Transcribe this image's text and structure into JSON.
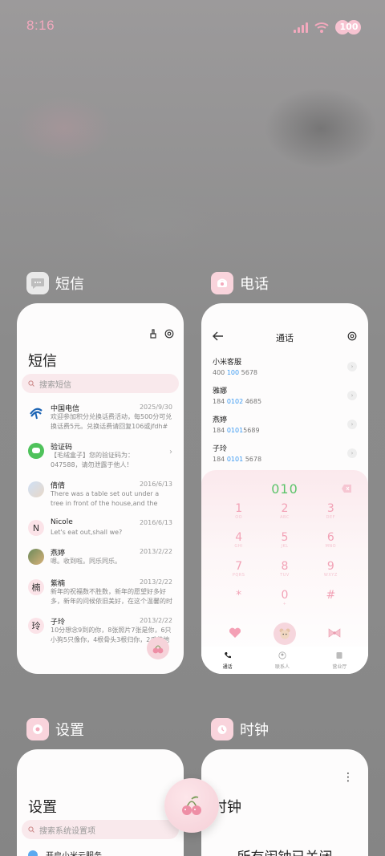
{
  "status_bar": {
    "time": "8:16",
    "battery": "100"
  },
  "apps": [
    {
      "name": "短信"
    },
    {
      "name": "电话"
    },
    {
      "name": "设置"
    },
    {
      "name": "时钟"
    }
  ],
  "sms": {
    "title": "短信",
    "search_placeholder": "搜索短信",
    "messages": [
      {
        "name": "中国电信",
        "date": "2025/9/30",
        "preview": "欢迎参加积分兑换话费活动，每500分可兑换话费5元。兑换话费请回复106或jfdh#话费..."
      },
      {
        "name": "验证码",
        "date": "",
        "preview": "【毛绒盒子】您的验证码为：047588，请勿泄露于他人！"
      },
      {
        "name": "倩倩",
        "date": "2016/6/13",
        "preview": "There was a table set out under a tree in front of the house,and the March Hare an..."
      },
      {
        "name": "Nicole",
        "date": "2016/6/13",
        "preview": "Let's eat out,shall we?"
      },
      {
        "name": "燕婷",
        "date": "2013/2/22",
        "preview": "嗯。收到啦。同乐同乐。"
      },
      {
        "name": "紫楠",
        "date": "2013/2/22",
        "preview": "新年的祝福数不胜数，新年的愿望好多好多，新年的问候依旧美好，在这个温馨的时刻..."
      },
      {
        "name": "子玲",
        "date": "2013/2/22",
        "preview": "10分想念9到的你，8张照片7张是你，6只小狗5只像你，4根骨头3根归你，2爪着地1定..."
      }
    ],
    "avatar_letters": [
      "N",
      "楠",
      "玲"
    ]
  },
  "phone": {
    "title": "通话",
    "contacts": [
      {
        "name": "小米客服",
        "pre": "400 ",
        "hl": "100",
        "post": " 5678"
      },
      {
        "name": "雅娜",
        "pre": "184 ",
        "hl": "0102",
        "post": " 4685"
      },
      {
        "name": "燕婷",
        "pre": "184 ",
        "hl": "0101",
        "post": "5689"
      },
      {
        "name": "子玲",
        "pre": "184 ",
        "hl": "0101",
        "post": " 5678"
      }
    ],
    "dial_number": "010",
    "keys": [
      {
        "d": "1",
        "s": "OO"
      },
      {
        "d": "2",
        "s": "ABC"
      },
      {
        "d": "3",
        "s": "DEF"
      },
      {
        "d": "4",
        "s": "GHI"
      },
      {
        "d": "5",
        "s": "JKL"
      },
      {
        "d": "6",
        "s": "MNO"
      },
      {
        "d": "7",
        "s": "PQRS"
      },
      {
        "d": "8",
        "s": "TUV"
      },
      {
        "d": "9",
        "s": "WXYZ"
      },
      {
        "d": "*",
        "s": ""
      },
      {
        "d": "0",
        "s": "+"
      },
      {
        "d": "#",
        "s": ""
      }
    ],
    "tabs": [
      "通话",
      "联系人",
      "营业厅"
    ]
  },
  "settings": {
    "title": "设置",
    "search_placeholder": "搜索系统设置项",
    "first_item": "开启小米云服务"
  },
  "clock": {
    "title": "时钟",
    "empty_text": "所有闹钟已关闭"
  },
  "colors": {
    "accent_pink": "#f2a2b6",
    "green": "#5cc46a",
    "blue": "#3b9af2"
  }
}
